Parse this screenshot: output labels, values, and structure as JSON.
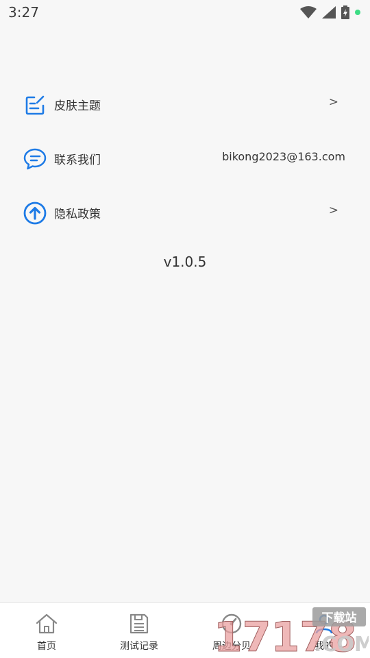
{
  "status_bar": {
    "time": "3:27"
  },
  "menu": {
    "skin_theme_label": "皮肤主题",
    "skin_theme_arrow": ">",
    "contact_label": "联系我们",
    "contact_value": "bikong2023@163.com",
    "privacy_label": "隐私政策",
    "privacy_arrow": ">"
  },
  "version": "v1.0.5",
  "bottom_nav": {
    "items": [
      {
        "label": "首页",
        "icon": "home-icon"
      },
      {
        "label": "测试记录",
        "icon": "save-icon"
      },
      {
        "label": "周边分贝",
        "icon": "gauge-icon"
      },
      {
        "label": "我的",
        "icon": "profile-icon"
      }
    ]
  },
  "watermark": {
    "text": "17178",
    "sub": "下载站",
    "suffix": ".COM"
  },
  "colors": {
    "accent": "#1e7be6",
    "green": "#3ddc84"
  }
}
